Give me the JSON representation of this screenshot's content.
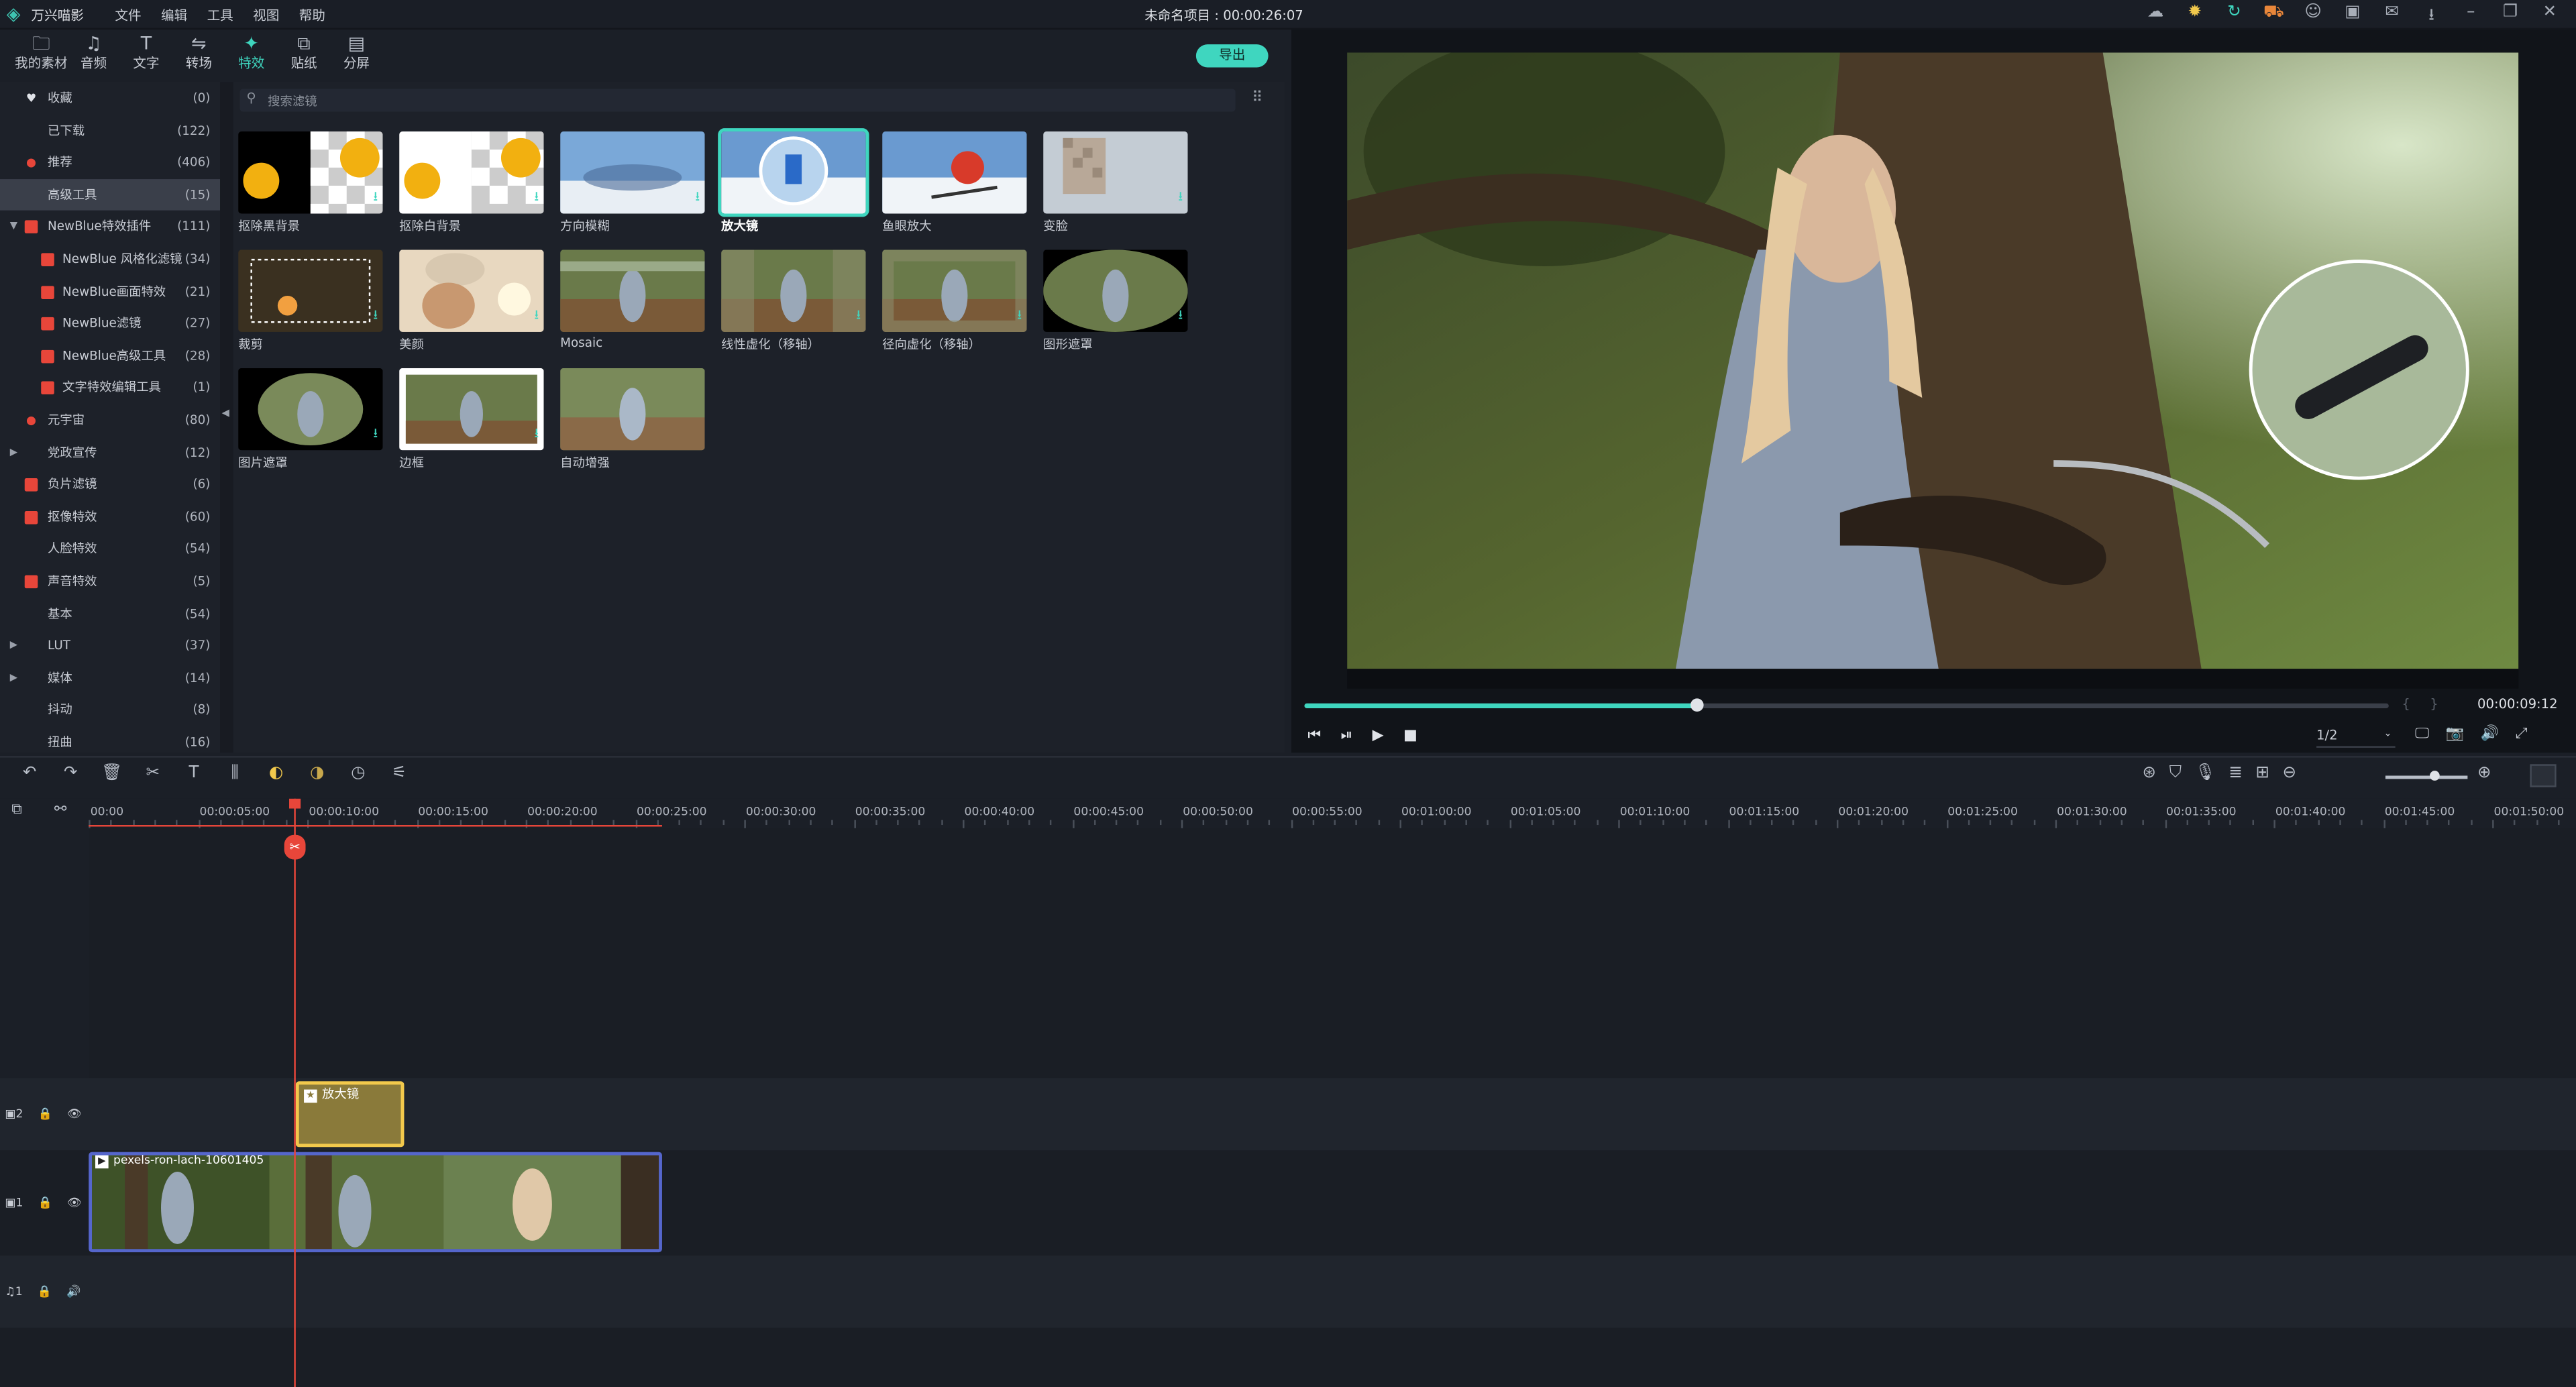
{
  "app": {
    "name": "万兴喵影",
    "project_title": "未命名项目 : 00:00:26:07"
  },
  "menu": [
    "文件",
    "编辑",
    "工具",
    "视图",
    "帮助"
  ],
  "toolbar_icons": [
    "cloud-icon",
    "bulb-icon",
    "refresh-icon",
    "cart-icon",
    "user-icon",
    "save-icon",
    "mail-icon",
    "download-icon",
    "minimize-icon",
    "restore-icon",
    "close-icon"
  ],
  "top_tabs": [
    {
      "label": "我的素材",
      "icon": "🗀"
    },
    {
      "label": "音频",
      "icon": "♫"
    },
    {
      "label": "文字",
      "icon": "T"
    },
    {
      "label": "转场",
      "icon": "⇋"
    },
    {
      "label": "特效",
      "icon": "✦"
    },
    {
      "label": "贴纸",
      "icon": "⧉"
    },
    {
      "label": "分屏",
      "icon": "▤"
    }
  ],
  "active_tab": "特效",
  "export_label": "导出",
  "categories": [
    {
      "label": "收藏",
      "count": "(0)",
      "icon": "♥",
      "level": 0
    },
    {
      "label": "已下载",
      "count": "(122)",
      "level": 1
    },
    {
      "label": "推荐",
      "count": "(406)",
      "icon": "●",
      "level": 0
    },
    {
      "label": "高级工具",
      "count": "(15)",
      "level": 1,
      "selected": true
    },
    {
      "label": "NewBlue特效插件",
      "count": "(111)",
      "icon": "■",
      "arrow": "▼",
      "level": 0
    },
    {
      "label": "NewBlue 风格化滤镜",
      "count": "(34)",
      "icon": "■",
      "level": 1
    },
    {
      "label": "NewBlue画面特效",
      "count": "(21)",
      "icon": "■",
      "level": 1
    },
    {
      "label": "NewBlue滤镜",
      "count": "(27)",
      "icon": "■",
      "level": 1
    },
    {
      "label": "NewBlue高级工具",
      "count": "(28)",
      "icon": "■",
      "level": 1
    },
    {
      "label": "文字特效编辑工具",
      "count": "(1)",
      "icon": "■",
      "level": 1
    },
    {
      "label": "元宇宙",
      "count": "(80)",
      "icon": "●",
      "level": 0
    },
    {
      "label": "党政宣传",
      "count": "(12)",
      "arrow": "▶",
      "level": 0
    },
    {
      "label": "负片滤镜",
      "count": "(6)",
      "icon": "■",
      "level": 0
    },
    {
      "label": "抠像特效",
      "count": "(60)",
      "icon": "■",
      "level": 0
    },
    {
      "label": "人脸特效",
      "count": "(54)",
      "level": 1
    },
    {
      "label": "声音特效",
      "count": "(5)",
      "icon": "■",
      "level": 0
    },
    {
      "label": "基本",
      "count": "(54)",
      "level": 1
    },
    {
      "label": "LUT",
      "count": "(37)",
      "arrow": "▶",
      "level": 0
    },
    {
      "label": "媒体",
      "count": "(14)",
      "arrow": "▶",
      "level": 0
    },
    {
      "label": "抖动",
      "count": "(8)",
      "level": 1
    },
    {
      "label": "扭曲",
      "count": "(16)",
      "level": 1
    }
  ],
  "search": {
    "placeholder": "搜索滤镜"
  },
  "effects": [
    {
      "label": "抠除黑背景",
      "selected": false
    },
    {
      "label": "抠除白背景",
      "selected": false
    },
    {
      "label": "方向模糊",
      "selected": false
    },
    {
      "label": "放大镜",
      "selected": true
    },
    {
      "label": "鱼眼放大",
      "selected": false
    },
    {
      "label": "变脸",
      "selected": false
    },
    {
      "label": "裁剪",
      "selected": false
    },
    {
      "label": "美颜",
      "selected": false
    },
    {
      "label": "Mosaic",
      "selected": false
    },
    {
      "label": "线性虚化（移轴）",
      "selected": false
    },
    {
      "label": "径向虚化（移轴）",
      "selected": false
    },
    {
      "label": "图形遮罩",
      "selected": false
    },
    {
      "label": "图片遮罩",
      "selected": false
    },
    {
      "label": "边框",
      "selected": false
    },
    {
      "label": "自动增强",
      "selected": false
    }
  ],
  "preview": {
    "timecode": "00:00:09:12",
    "progress": 0.362,
    "ratio": "1/2",
    "mark_in": "{",
    "mark_out": "}"
  },
  "playback_controls": [
    "⏮",
    "⏯",
    "▶",
    "■"
  ],
  "preview_icons": [
    "🖵",
    "📷",
    "🔊",
    "⤢"
  ],
  "timeline_tools": [
    "↶",
    "↷",
    "🗑",
    "✂",
    "T",
    "⫼",
    "◐",
    "◑",
    "◷",
    "⚟"
  ],
  "timeline_right_tools": [
    "⊛",
    "⛉",
    "🎙",
    "≣",
    "⊞"
  ],
  "zoom": {
    "minus": "⊖",
    "plus": "⊕",
    "level": 0.6
  },
  "ruler_ticks": [
    "00:00",
    "00:00:05:00",
    "00:00:10:00",
    "00:00:15:00",
    "00:00:20:00",
    "00:00:25:00",
    "00:00:30:00",
    "00:00:35:00",
    "00:00:40:00",
    "00:00:45:00",
    "00:00:50:00",
    "00:00:55:00",
    "00:01:00:00",
    "00:01:05:00",
    "00:01:10:00",
    "00:01:15:00",
    "00:01:20:00",
    "00:01:25:00",
    "00:01:30:00",
    "00:01:35:00",
    "00:01:40:00",
    "00:01:45:00",
    "00:01:50:00"
  ],
  "tracks": [
    {
      "id": "▣2",
      "lock": "🔒",
      "toggle": "👁"
    },
    {
      "id": "▣1",
      "lock": "🔒",
      "toggle": "👁"
    },
    {
      "id": "♫1",
      "lock": "🔒",
      "toggle": "🔊"
    }
  ],
  "clips": {
    "effect_clip": "放大镜",
    "video_clip": "pexels-ron-lach-10601405"
  },
  "playhead_glyph": "✂"
}
